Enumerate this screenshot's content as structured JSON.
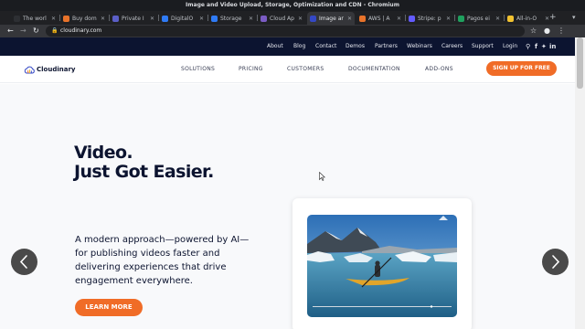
{
  "window": {
    "title": "Image and Video Upload, Storage, Optimization and CDN - Chromium"
  },
  "tabs": [
    {
      "label": "The worl",
      "color": "#2d2f33"
    },
    {
      "label": "Buy dom",
      "color": "#e8732a"
    },
    {
      "label": "Private I",
      "color": "#5b5fc7"
    },
    {
      "label": "DigitalO",
      "color": "#2f7bf5"
    },
    {
      "label": "Storage",
      "color": "#2f7bf5"
    },
    {
      "label": "Cloud Ap",
      "color": "#7b5cc4"
    },
    {
      "label": "Image ar",
      "color": "#3448c5"
    },
    {
      "label": "AWS | A",
      "color": "#e8732a"
    },
    {
      "label": "Stripe: p",
      "color": "#635bff"
    },
    {
      "label": "Pagos ei",
      "color": "#1fa05e"
    },
    {
      "label": "All-in-O",
      "color": "#f2c230"
    }
  ],
  "active_tab_index": 6,
  "toolbar": {
    "url": "cloudinary.com",
    "new_tab": "+"
  },
  "utility_nav": [
    "About",
    "Blog",
    "Contact",
    "Demos",
    "Partners",
    "Webinars",
    "Careers",
    "Support",
    "Login"
  ],
  "utility_icons": {
    "search": "search-icon",
    "facebook": "f",
    "twitter": "twitter-icon",
    "linkedin": "in"
  },
  "logo": {
    "text": "Cloudinary"
  },
  "main_nav": [
    "SOLUTIONS",
    "PRICING",
    "CUSTOMERS",
    "DOCUMENTATION",
    "ADD-ONS"
  ],
  "signup": "SIGN UP FOR FREE",
  "hero": {
    "headline_line1": "Video.",
    "headline_line2": "Just Got Easier.",
    "subtext_lines": [
      "A modern approach—powered by AI—",
      "for publishing videos faster and",
      "delivering experiences that drive",
      "engagement everywhere."
    ],
    "cta": "LEARN MORE"
  },
  "colors": {
    "accent": "#f06c27",
    "navy": "#0c1430"
  }
}
